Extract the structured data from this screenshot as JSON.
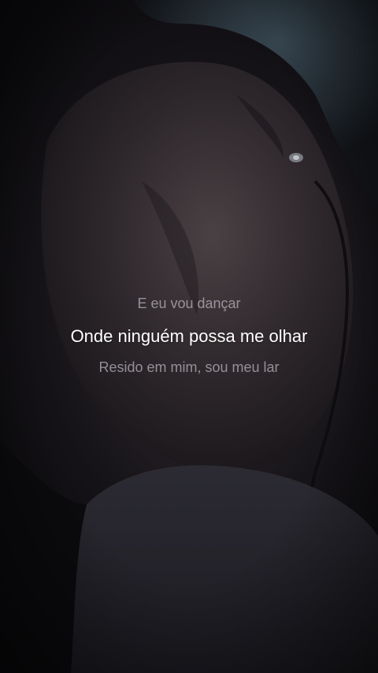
{
  "lyrics": {
    "previous": "E eu vou dançar",
    "current": "Onde ninguém possa me olhar",
    "next": "Resido em mim, sou meu lar"
  },
  "colors": {
    "background": "#0d0c10",
    "skin_highlight": "#3d3538",
    "current_line": "#ffffff",
    "dim_line": "#bdb8c2"
  }
}
